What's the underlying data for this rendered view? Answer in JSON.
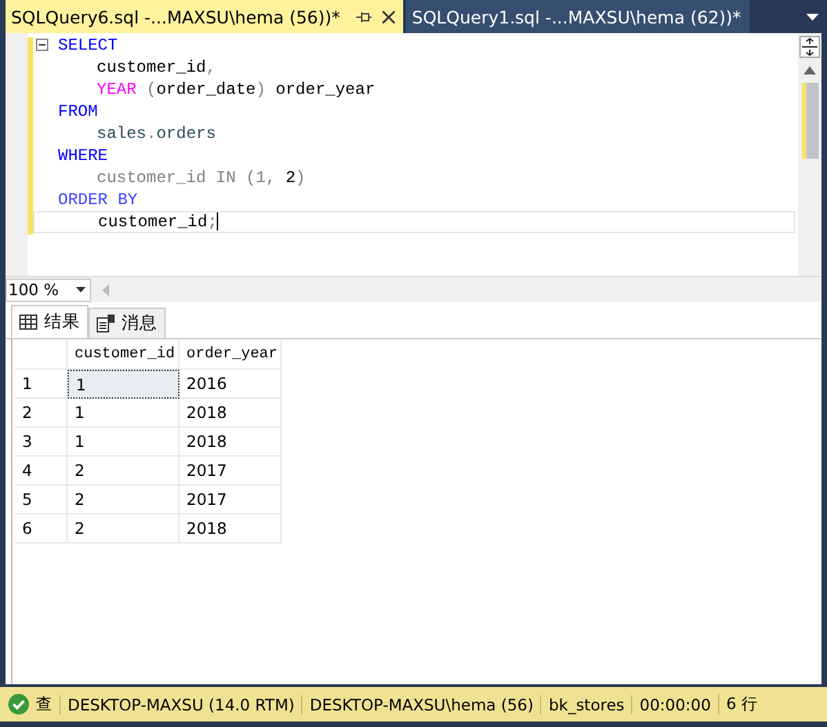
{
  "document_tabs": [
    {
      "label": "SQLQuery6.sql -...MAXSU\\hema (56))*",
      "selected": true
    },
    {
      "label": "SQLQuery1.sql -...MAXSU\\hema (62))*",
      "selected": false
    }
  ],
  "editor": {
    "lines": [
      {
        "indented": false,
        "collapsible": true,
        "current": false,
        "tokens": [
          {
            "text": "SELECT",
            "kind": "keyword"
          }
        ]
      },
      {
        "indented": true,
        "collapsible": false,
        "current": false,
        "tokens": [
          {
            "text": "customer_id",
            "kind": "name"
          },
          {
            "text": ",",
            "kind": "operator"
          }
        ]
      },
      {
        "indented": true,
        "collapsible": false,
        "current": false,
        "tokens": [
          {
            "text": "YEAR",
            "kind": "function"
          },
          {
            "text": " (",
            "kind": "operator"
          },
          {
            "text": "order_date",
            "kind": "name"
          },
          {
            "text": ")",
            "kind": "operator"
          },
          {
            "text": " order_year",
            "kind": "name"
          }
        ]
      },
      {
        "indented": false,
        "collapsible": false,
        "current": false,
        "tokens": [
          {
            "text": "FROM",
            "kind": "keyword"
          }
        ]
      },
      {
        "indented": true,
        "collapsible": false,
        "current": false,
        "tokens": [
          {
            "text": "sales",
            "kind": "object"
          },
          {
            "text": ".",
            "kind": "operator"
          },
          {
            "text": "orders",
            "kind": "object"
          }
        ]
      },
      {
        "indented": false,
        "collapsible": false,
        "current": false,
        "tokens": [
          {
            "text": "WHERE",
            "kind": "keyword"
          }
        ]
      },
      {
        "indented": true,
        "collapsible": false,
        "current": false,
        "tokens": [
          {
            "text": "customer_id",
            "kind": "dim"
          },
          {
            "text": " IN (",
            "kind": "operator"
          },
          {
            "text": "1",
            "kind": "dim"
          },
          {
            "text": ", ",
            "kind": "operator"
          },
          {
            "text": "2",
            "kind": "name"
          },
          {
            "text": ")",
            "kind": "operator"
          }
        ]
      },
      {
        "indented": false,
        "collapsible": false,
        "current": false,
        "tokens": [
          {
            "text": "ORDER BY",
            "kind": "keyword2"
          }
        ]
      },
      {
        "indented": true,
        "collapsible": false,
        "current": true,
        "tokens": [
          {
            "text": "customer_id",
            "kind": "name"
          },
          {
            "text": ";",
            "kind": "operator"
          }
        ]
      }
    ]
  },
  "zoom": {
    "value": "100 %"
  },
  "result_tabs": [
    {
      "label": "结果",
      "kind": "grid",
      "selected": true
    },
    {
      "label": "消息",
      "kind": "messages",
      "selected": false
    }
  ],
  "results": {
    "columns": [
      "customer_id",
      "order_year"
    ],
    "rows": [
      {
        "number": "1",
        "cells": [
          {
            "text": "1",
            "focused": true
          },
          {
            "text": "2016",
            "focused": false
          }
        ]
      },
      {
        "number": "2",
        "cells": [
          {
            "text": "1",
            "focused": false
          },
          {
            "text": "2018",
            "focused": false
          }
        ]
      },
      {
        "number": "3",
        "cells": [
          {
            "text": "1",
            "focused": false
          },
          {
            "text": "2018",
            "focused": false
          }
        ]
      },
      {
        "number": "4",
        "cells": [
          {
            "text": "2",
            "focused": false
          },
          {
            "text": "2017",
            "focused": false
          }
        ]
      },
      {
        "number": "5",
        "cells": [
          {
            "text": "2",
            "focused": false
          },
          {
            "text": "2017",
            "focused": false
          }
        ]
      },
      {
        "number": "6",
        "cells": [
          {
            "text": "2",
            "focused": false
          },
          {
            "text": "2018",
            "focused": false
          }
        ]
      }
    ]
  },
  "status_bar": {
    "query_status": "查",
    "succeeded": true,
    "items": [
      "DESKTOP-MAXSU (14.0 RTM)",
      "DESKTOP-MAXSU\\hema (56)",
      "bk_stores",
      "00:00:00",
      "6 行"
    ]
  }
}
